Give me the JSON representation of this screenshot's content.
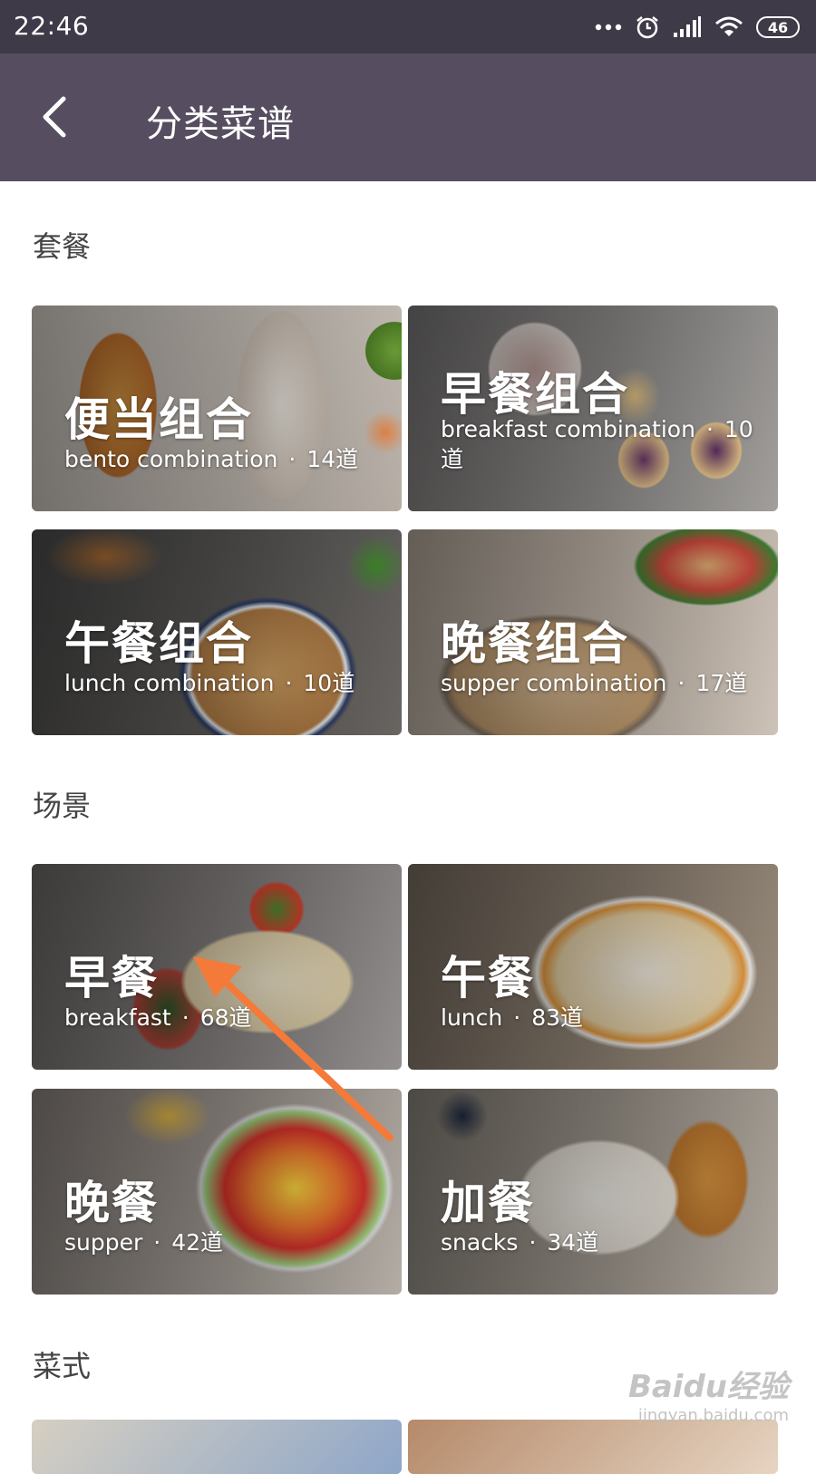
{
  "status_bar": {
    "time": "22:46",
    "battery": "46",
    "icons": [
      "more-dots-icon",
      "alarm-icon",
      "signal-icon",
      "wifi-icon",
      "battery-icon"
    ]
  },
  "header": {
    "title": "分类菜谱",
    "back_icon": "back-arrow-icon"
  },
  "sections": [
    {
      "title": "套餐",
      "cards": [
        {
          "title": "便当组合",
          "subtitle": "bento combination",
          "count": "14道"
        },
        {
          "title": "早餐组合",
          "subtitle": "breakfast combination",
          "count": "10道"
        },
        {
          "title": "午餐组合",
          "subtitle": "lunch combination",
          "count": "10道"
        },
        {
          "title": "晚餐组合",
          "subtitle": "supper combination",
          "count": "17道"
        }
      ]
    },
    {
      "title": "场景",
      "cards": [
        {
          "title": "早餐",
          "subtitle": "breakfast",
          "count": "68道"
        },
        {
          "title": "午餐",
          "subtitle": "lunch",
          "count": "83道"
        },
        {
          "title": "晚餐",
          "subtitle": "supper",
          "count": "42道"
        },
        {
          "title": "加餐",
          "subtitle": "snacks",
          "count": "34道"
        }
      ]
    },
    {
      "title": "菜式",
      "cards": []
    }
  ],
  "separator": "·",
  "annotation": {
    "color": "#f47a3a"
  },
  "colors": {
    "status_bar": "#3f3a48",
    "header": "#564d60"
  },
  "watermark": {
    "logo": "Baidu经验",
    "url": "jingyan.baidu.com"
  }
}
